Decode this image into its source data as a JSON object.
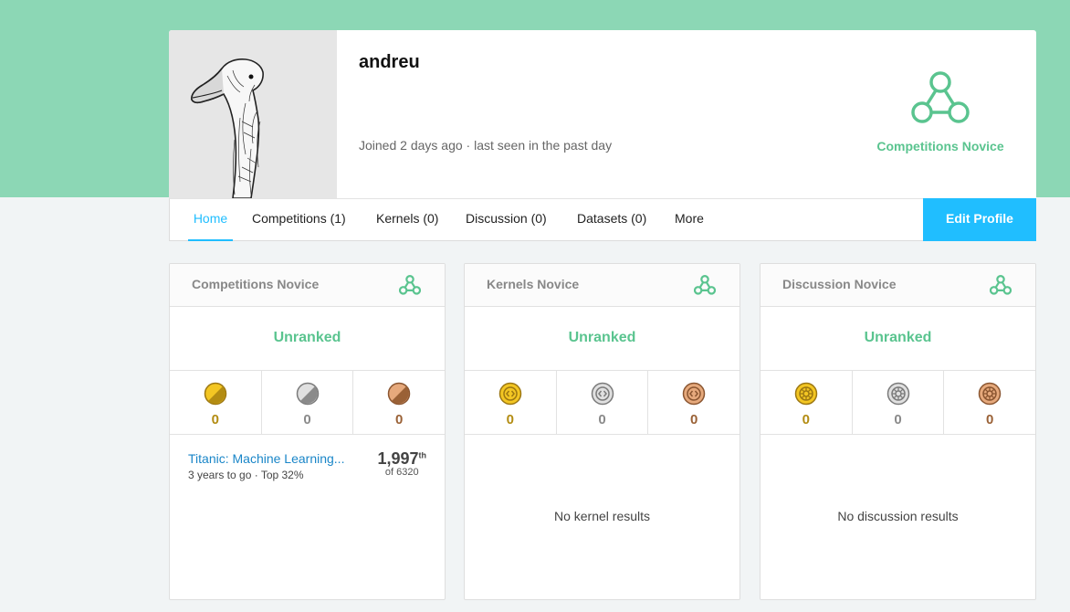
{
  "profile": {
    "username": "andreu",
    "joined": "Joined 2 days ago · last seen in the past day",
    "tier": "Competitions Novice"
  },
  "nav": {
    "tabs": [
      "Home",
      "Competitions (1)",
      "Kernels (0)",
      "Discussion (0)",
      "Datasets (0)",
      "More"
    ],
    "active_tab": "Home",
    "edit_profile": "Edit Profile"
  },
  "cards": [
    {
      "title": "Competitions Novice",
      "rank": "Unranked",
      "medals": {
        "gold": "0",
        "silver": "0",
        "bronze": "0"
      },
      "entry": {
        "name": "Titanic: Machine Learning...",
        "meta": "3 years to go · Top 32%",
        "rank": "1,997",
        "rank_suffix": "th",
        "of_total": "of 6320"
      }
    },
    {
      "title": "Kernels Novice",
      "rank": "Unranked",
      "medals": {
        "gold": "0",
        "silver": "0",
        "bronze": "0"
      },
      "empty": "No kernel results"
    },
    {
      "title": "Discussion Novice",
      "rank": "Unranked",
      "medals": {
        "gold": "0",
        "silver": "0",
        "bronze": "0"
      },
      "empty": "No discussion results"
    }
  ],
  "colors": {
    "banner": "#8cd7b5",
    "accent": "#20beff",
    "novice": "#5ac48f",
    "gold": "#e8b51c",
    "silver": "#8f8f8f",
    "bronze": "#b06d3f"
  },
  "icons": [
    "novice-tier-icon",
    "competition-medal-icon",
    "kernel-medal-icon",
    "discussion-medal-icon"
  ]
}
